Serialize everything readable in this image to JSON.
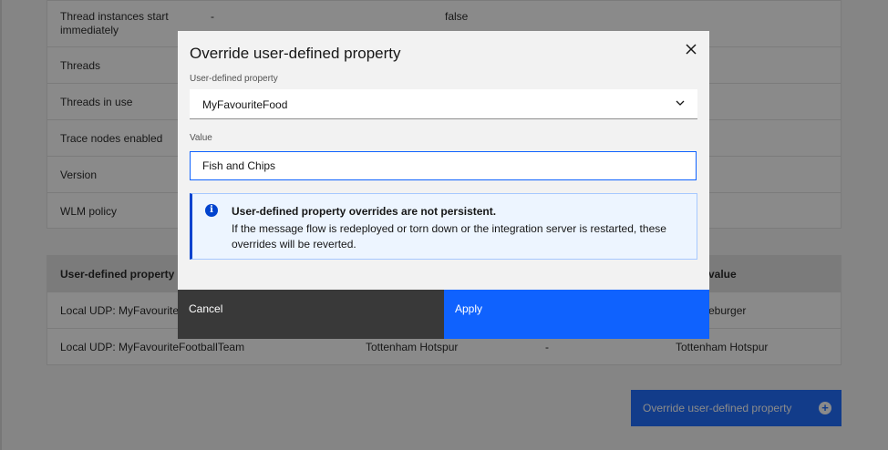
{
  "properties_table": {
    "rows": [
      {
        "name": "Thread instances start immediately",
        "name_line1": "Thread instances start",
        "name_line2": "immediately",
        "value": "-",
        "value2": "false"
      },
      {
        "name": "Threads"
      },
      {
        "name": "Threads in use"
      },
      {
        "name": "Trace nodes enabled"
      },
      {
        "name": "Version"
      },
      {
        "name": "WLM policy"
      }
    ]
  },
  "udp_table": {
    "header_property": "User-defined property",
    "header_value_partial": "value",
    "rows": [
      {
        "property_partial": "Local UDP: MyFavouriteF",
        "value_partial": "eburger"
      },
      {
        "property": "Local UDP: MyFavouriteFootballTeam",
        "value": "Tottenham Hotspur",
        "override": "-",
        "current": "Tottenham Hotspur"
      }
    ]
  },
  "background_button": {
    "label": "Override user-defined property",
    "icon": "add-filled-icon"
  },
  "modal": {
    "title": "Override user-defined property",
    "close_icon": "close-icon",
    "property_label": "User-defined property",
    "property_selected": "MyFavouriteFood",
    "value_label": "Value",
    "value_input": "Fish and Chips",
    "notice": {
      "icon": "info-icon",
      "title": "User-defined property overrides are not persistent.",
      "body": "If the message flow is redeployed or torn down or the integration server is restarted, these overrides will be reverted."
    },
    "cancel_label": "Cancel",
    "apply_label": "Apply"
  },
  "colors": {
    "primary": "#0f62fe",
    "secondary_button": "#393939",
    "notice_bg": "#edf5ff",
    "notice_accent": "#0043ce"
  }
}
